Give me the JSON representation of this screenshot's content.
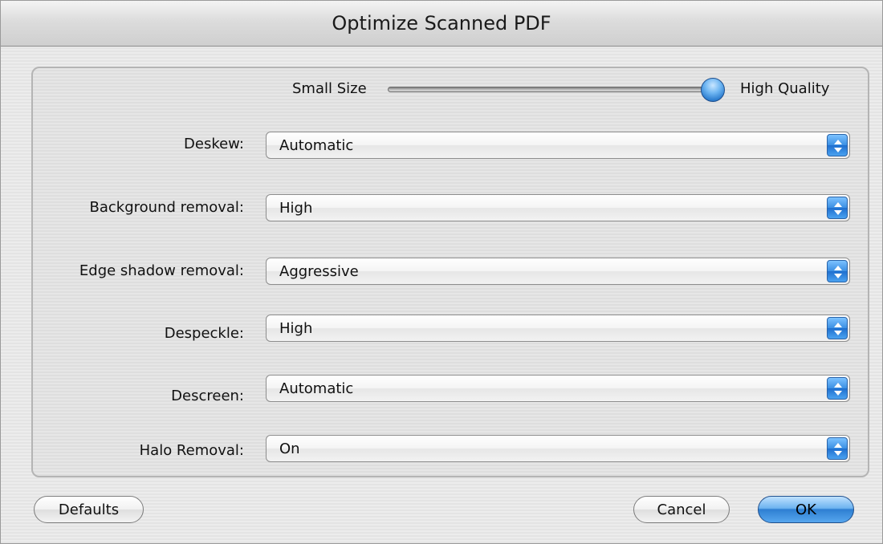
{
  "window": {
    "title": "Optimize Scanned PDF"
  },
  "slider": {
    "left_label": "Small Size",
    "right_label": "High Quality",
    "value_fraction": 1.0
  },
  "rows": [
    {
      "label": "Deskew:",
      "value": "Automatic"
    },
    {
      "label": "Background removal:",
      "value": "High"
    },
    {
      "label": "Edge shadow removal:",
      "value": "Aggressive"
    },
    {
      "label": "Despeckle:",
      "value": "High"
    },
    {
      "label": "Descreen:",
      "value": "Automatic"
    },
    {
      "label": "Halo Removal:",
      "value": "On"
    }
  ],
  "buttons": {
    "defaults": "Defaults",
    "cancel": "Cancel",
    "ok": "OK"
  },
  "colors": {
    "accent_blue": "#2e7fd2"
  }
}
